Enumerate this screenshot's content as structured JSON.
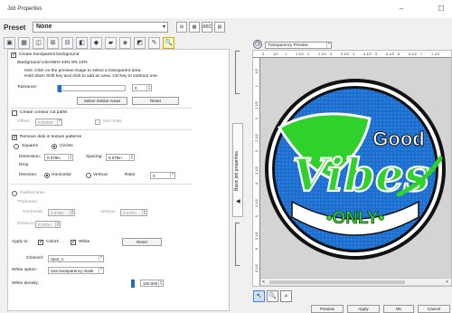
{
  "window": {
    "title": "Job Properties",
    "minimize_glyph": "–",
    "maximize_glyph": "☐"
  },
  "preset": {
    "label": "Preset",
    "value": "None",
    "arrow": "▾"
  },
  "preset_buttons": [
    "⊞",
    "▦",
    "ABC",
    "▤"
  ],
  "toolbar": {
    "icons": [
      "job-icon",
      "page-icon",
      "tile-icon",
      "marks-icon",
      "layout-icon",
      "image-icon",
      "color-icon",
      "spot-icon",
      "transparency-icon",
      "crop-icon",
      "special-icon",
      "search-icon"
    ],
    "glyphs": [
      "▣",
      "▦",
      "◫",
      "⊞",
      "⊟",
      "◧",
      "◆",
      "▰",
      "◈",
      "◩",
      "✎",
      "🔍"
    ]
  },
  "transparency": {
    "create_label": "Create transparent background",
    "create_checked": "✓",
    "bg_color_label": "Background color:",
    "bg_color_value": "86% 54% 9% 19%",
    "hint_line1": "Hint: Click on the preview image to select a transparent area.",
    "hint_line2": "Hold down Shift key and click to add an area. Ctrl key to subtract one.",
    "tolerance_label": "Tolerance:",
    "tolerance_value": "0",
    "select_similar_label": "Select Similar Areas",
    "reset_label": "Reset"
  },
  "contour": {
    "create_label": "Create contour cut paths",
    "offset_label": "Offset:",
    "offset_value": "0.00000",
    "trim_holes_label": "trim holes"
  },
  "texture": {
    "remove_dots_label": "Remove dots in texture patterns",
    "remove_dots_checked": "✓",
    "squares_label": "Squares",
    "circles_label": "Circles",
    "dimension_label": "Dimension:",
    "dimension_value": "0.079in",
    "spacing_label": "Spacing:",
    "spacing_value": "0.079in",
    "drop_label": "Drop",
    "direction_label": "Direction:",
    "horizontal_label": "Horizontal",
    "vertical_label": "Vertical",
    "ratio_label": "Ratio:",
    "ratio_value": "0"
  },
  "overlap": {
    "dashed_lines_label": "Dashed lines",
    "thickness_label": "Thickness",
    "horizontal_label": "Horizontal:",
    "horizontal_value": "0.079in",
    "vertical_label": "Vertical:",
    "vertical_value": "0.037in",
    "distance_label": "Distance:",
    "distance_value": "0.157in"
  },
  "apply": {
    "apply_to_label": "Apply to:",
    "colors_label": "Colors",
    "white_label": "White",
    "checked": "✓",
    "reset_label": "Reset"
  },
  "channel": {
    "channel_label": "Channel:",
    "channel_value": "Spot_1",
    "white_option_label": "White option:",
    "white_option_value": "Use transparency mask",
    "white_density_label": "White density:",
    "white_density_value": "100.000"
  },
  "side_tab": {
    "label": "Basic job properties",
    "arrow_glyph": "◀"
  },
  "preview": {
    "clock_glyph": "◷",
    "mode_value": "Transparency Preview",
    "ruler_h": [
      "0",
      "1/2",
      "1",
      "1 1/2",
      "2",
      "2 1/2",
      "3",
      "3 1/2",
      "4",
      "4 1/2",
      "5",
      "5 1/2",
      "6",
      "6 1/2",
      "7",
      "7 1/2"
    ],
    "ruler_v": [
      "1/2",
      "1",
      "1 1/2",
      "2",
      "2 1/2",
      "3",
      "3 1/2",
      "4",
      "4 1/2",
      "5",
      "5 1/2",
      "6",
      "6 1/2"
    ],
    "scroll_left": "<",
    "scroll_right": ">"
  },
  "artwork": {
    "word_good": "Good",
    "word_vibes": "Vibes",
    "word_only": "•ONLY•",
    "colors": {
      "blue": "#1a6fd1",
      "green": "#2fd12a",
      "white": "#ffffff",
      "black": "#111111",
      "gray": "#8e8e8e"
    }
  },
  "bottom_tools": {
    "glyphs": [
      "↖",
      "🔍",
      "⌕"
    ]
  },
  "footer_buttons": [
    "Preview",
    "Apply",
    "OK",
    "Cancel"
  ]
}
